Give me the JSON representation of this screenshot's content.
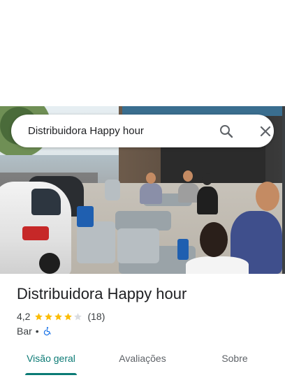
{
  "search": {
    "query": "Distribuidora Happy hour",
    "search_icon": "search-icon",
    "close_icon": "close-icon"
  },
  "place": {
    "name": "Distribuidora Happy hour",
    "rating": "4,2",
    "rating_value": 4.2,
    "stars_total": 5,
    "review_count": "(18)",
    "category": "Bar",
    "separator": "•",
    "accessibility_icon": "wheelchair-icon"
  },
  "tabs": [
    {
      "label": "Visão geral",
      "active": true
    },
    {
      "label": "Avaliações",
      "active": false
    },
    {
      "label": "Sobre",
      "active": false
    }
  ],
  "colors": {
    "accent": "#0b7a75",
    "star": "#fbbc04",
    "star_empty": "#dadce0",
    "text_primary": "#202124",
    "text_secondary": "#3c4043"
  }
}
